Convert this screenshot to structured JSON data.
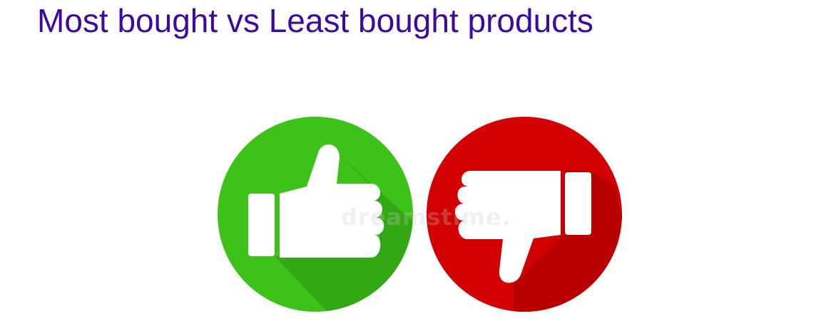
{
  "page": {
    "title": "Most bought vs Least bought products"
  },
  "icons": {
    "like": {
      "name": "thumbs-up-icon",
      "circle_color": "#3cc219",
      "shadow_color": "#32a814",
      "glyph_color": "#ffffff"
    },
    "dislike": {
      "name": "thumbs-down-icon",
      "circle_color": "#d20000",
      "shadow_color": "#b80000",
      "glyph_color": "#ffffff"
    }
  },
  "watermark": {
    "text": "dreamstime."
  }
}
